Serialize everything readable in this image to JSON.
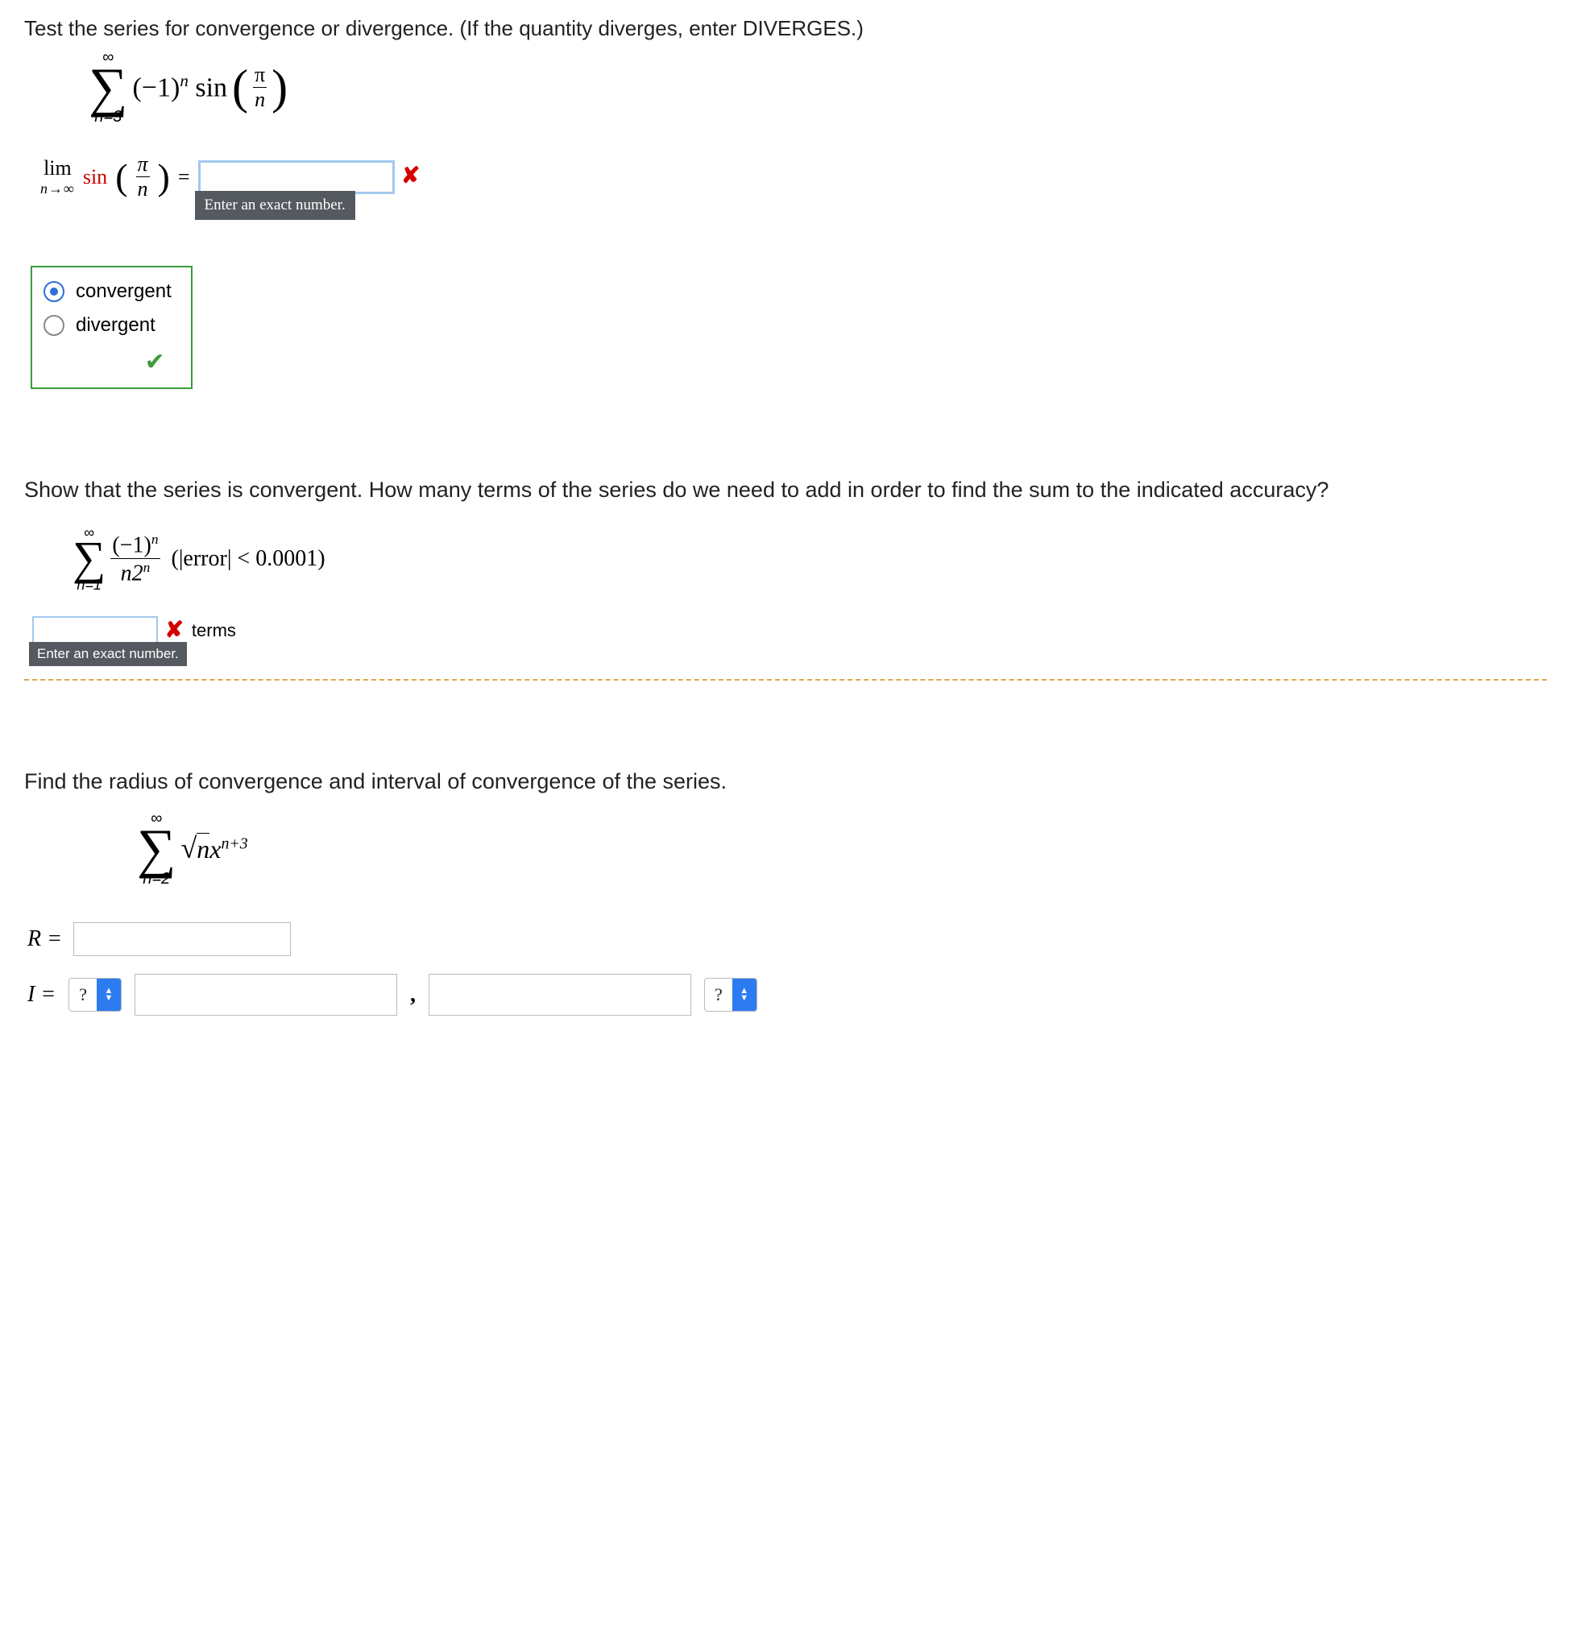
{
  "q1": {
    "prompt": "Test the series for convergence or divergence. (If the quantity diverges, enter DIVERGES.)",
    "sum_top": "∞",
    "sum_bot": "n=3",
    "term_a": "(−1)",
    "term_a_sup": "n",
    "term_b": " sin",
    "frac_top": "π",
    "frac_bot": "n",
    "lim_l1": "lim",
    "lim_l2": "n→∞",
    "sin": "sin",
    "lp_frac_top": "π",
    "lp_frac_bot": "n",
    "eq": " = ",
    "tooltip": "Enter an exact number.",
    "opt1": "convergent",
    "opt2": "divergent"
  },
  "q2": {
    "prompt": "Show that the series is convergent. How many terms of the series do we need to add in order to find the sum to the indicated accuracy?",
    "sum_top": "∞",
    "sum_bot": "n=1",
    "frac_top_a": "(−1)",
    "frac_top_sup": "n",
    "frac_bot_a": "n2",
    "frac_bot_sup": "n",
    "cond": "(|error| < 0.0001)",
    "tooltip": "Enter an exact number.",
    "terms_label": "terms"
  },
  "q3": {
    "prompt": "Find the radius of convergence and interval of convergence of the series.",
    "sum_top": "∞",
    "sum_bot": "n=2",
    "sqrt_in": "n",
    "x": "x",
    "x_sup": "n+3",
    "R_label": "R =",
    "I_label": "I =",
    "select_value": "?",
    "comma": ","
  }
}
